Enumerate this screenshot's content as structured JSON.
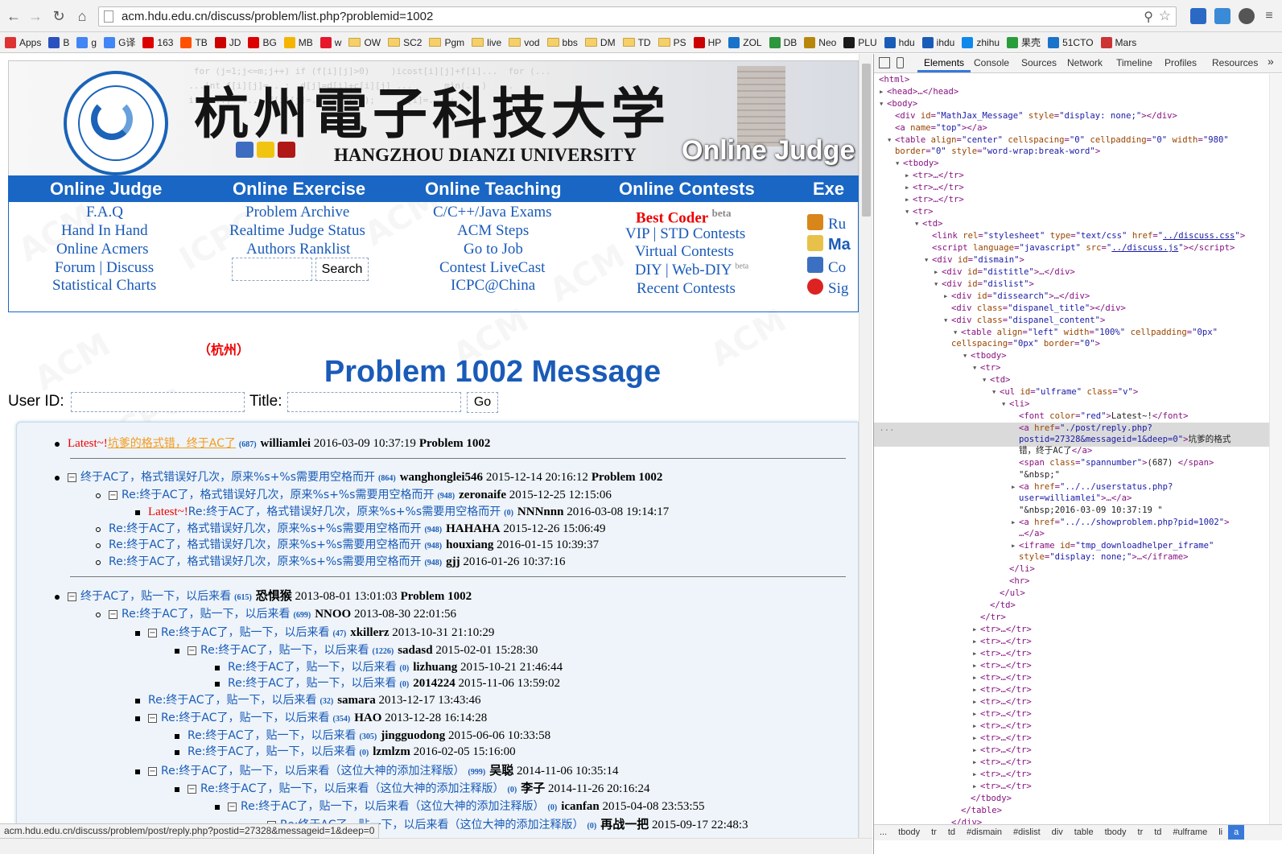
{
  "browser": {
    "url": "acm.hdu.edu.cn/discuss/problem/list.php?problemid=1002",
    "status_url": "acm.hdu.edu.cn/discuss/problem/post/reply.php?postid=27328&messageid=1&deep=0",
    "bookmarks": [
      {
        "label": "Apps",
        "icon": "apps-grid-icon",
        "color": "#d33"
      },
      {
        "label": "B",
        "icon": "baidu-icon",
        "color": "#2a52be"
      },
      {
        "label": "g",
        "icon": "google-icon",
        "color": "#4285f4"
      },
      {
        "label": "G译",
        "icon": "translate-icon",
        "color": "#4285f4"
      },
      {
        "label": "163",
        "icon": "netease-icon",
        "color": "#d00"
      },
      {
        "label": "TB",
        "icon": "taobao-icon",
        "color": "#ff5000"
      },
      {
        "label": "JD",
        "icon": "jd-icon",
        "color": "#c00"
      },
      {
        "label": "BG",
        "icon": "bg-icon",
        "color": "#d00"
      },
      {
        "label": "MB",
        "icon": "mb-icon",
        "color": "#f4b400"
      },
      {
        "label": "w",
        "icon": "weibo-icon",
        "color": "#e6162d"
      },
      {
        "label": "OW",
        "icon": "folder-icon"
      },
      {
        "label": "SC2",
        "icon": "folder-icon"
      },
      {
        "label": "Pgm",
        "icon": "folder-icon"
      },
      {
        "label": "live",
        "icon": "folder-icon"
      },
      {
        "label": "vod",
        "icon": "folder-icon"
      },
      {
        "label": "bbs",
        "icon": "folder-icon"
      },
      {
        "label": "DM",
        "icon": "folder-icon"
      },
      {
        "label": "TD",
        "icon": "folder-icon"
      },
      {
        "label": "PS",
        "icon": "folder-icon"
      },
      {
        "label": "HP",
        "icon": "hupu-icon",
        "color": "#c00"
      },
      {
        "label": "ZOL",
        "icon": "zol-icon",
        "color": "#1a73c9"
      },
      {
        "label": "DB",
        "icon": "douban-icon",
        "color": "#2e963d"
      },
      {
        "label": "Neo",
        "icon": "neo-icon",
        "color": "#b8860b"
      },
      {
        "label": "PLU",
        "icon": "plu-icon",
        "color": "#1a1a1a"
      },
      {
        "label": "hdu",
        "icon": "hdu-icon",
        "color": "#1a5bb8"
      },
      {
        "label": "ihdu",
        "icon": "ihdu-icon",
        "color": "#1a5bb8"
      },
      {
        "label": "zhihu",
        "icon": "zhihu-icon",
        "color": "#0f88eb"
      },
      {
        "label": "果壳",
        "icon": "guokr-icon",
        "color": "#2a9d3b"
      },
      {
        "label": "51CTO",
        "icon": "51cto-icon",
        "color": "#1a73c9"
      },
      {
        "label": "Mars",
        "icon": "mars-icon",
        "color": "#c33"
      }
    ]
  },
  "site": {
    "banner_cn": "杭州電子科技大学",
    "banner_en": "HANGZHOU DIANZI UNIVERSITY",
    "banner_oj": "Online Judge",
    "logo_ring": "HANGZHOU DIANZI UNIVERSITY",
    "nav": [
      {
        "head": "Online Judge",
        "links": [
          "F.A.Q",
          "Hand In Hand",
          "Online Acmers",
          "Forum | Discuss",
          "Statistical Charts"
        ]
      },
      {
        "head": "Online Exercise",
        "links": [
          "Problem Archive",
          "Realtime Judge Status",
          "Authors Ranklist"
        ]
      },
      {
        "head": "Online Teaching",
        "links": [
          "C/C++/Java Exams",
          "ACM Steps",
          "Go to Job",
          "Contest LiveCast",
          "ICPC@China"
        ]
      },
      {
        "head": "Online Contests",
        "links": [
          "Best Coder",
          "VIP | STD Contests",
          "Virtual Contests",
          "DIY | Web-DIY",
          "Recent Contests"
        ],
        "best_sup": "beta",
        "diy_sup": "beta"
      },
      {
        "head": "Exe",
        "links": [
          "Ru",
          "Ma",
          "Co",
          "Sig"
        ]
      }
    ],
    "search_button": "Search"
  },
  "discuss": {
    "city": "（杭州）",
    "title": "Problem 1002 Message",
    "userid_label": "User ID:",
    "title_label": "Title:",
    "go_label": "Go",
    "threads": [
      {
        "latest": "Latest~!",
        "title": "坑爹的格式错，终于AC了",
        "count": "(687)",
        "user": "williamlei",
        "time": "2016-03-09 10:37:19",
        "problem": "Problem 1002"
      },
      {
        "title": "终于AC了，格式错误好几次，原来%s+%s需要用空格而开",
        "count": "(864)",
        "user": "wanghonglei546",
        "time": "2015-12-14 20:16:12",
        "problem": "Problem 1002"
      },
      {
        "title": "Re:终于AC了，格式错误好几次，原来%s+%s需要用空格而开",
        "count": "(948)",
        "user": "zeronaife",
        "time": "2015-12-25 12:15:06"
      },
      {
        "latest": "Latest~!",
        "title": "Re:终于AC了，格式错误好几次，原来%s+%s需要用空格而开",
        "count": "(0)",
        "user": "NNNnnn",
        "time": "2016-03-08 19:14:17"
      },
      {
        "title": "Re:终于AC了，格式错误好几次，原来%s+%s需要用空格而开",
        "count": "(948)",
        "user": "HAHAHA",
        "time": "2015-12-26 15:06:49"
      },
      {
        "title": "Re:终于AC了，格式错误好几次，原来%s+%s需要用空格而开",
        "count": "(948)",
        "user": "houxiang",
        "time": "2016-01-15 10:39:37"
      },
      {
        "title": "Re:终于AC了，格式错误好几次，原来%s+%s需要用空格而开",
        "count": "(948)",
        "user": "gjj",
        "time": "2016-01-26 10:37:16"
      },
      {
        "title": "终于AC了，贴一下，以后来看",
        "count": "(615)",
        "user": "恐惧猴",
        "time": "2013-08-01 13:01:03",
        "problem": "Problem 1002"
      },
      {
        "title": "Re:终于AC了，贴一下，以后来看",
        "count": "(699)",
        "user": "NNOO",
        "time": "2013-08-30 22:01:56"
      },
      {
        "title": "Re:终于AC了，贴一下，以后来看",
        "count": "(47)",
        "user": "xkillerz",
        "time": "2013-10-31 21:10:29"
      },
      {
        "title": "Re:终于AC了，贴一下，以后来看",
        "count": "(1226)",
        "user": "sadasd",
        "time": "2015-02-01 15:28:30"
      },
      {
        "title": "Re:终于AC了，贴一下，以后来看",
        "count": "(0)",
        "user": "lizhuang",
        "time": "2015-10-21 21:46:44"
      },
      {
        "title": "Re:终于AC了，贴一下，以后来看",
        "count": "(0)",
        "user": "2014224",
        "time": "2015-11-06 13:59:02"
      },
      {
        "title": "Re:终于AC了，贴一下，以后来看",
        "count": "(32)",
        "user": "samara",
        "time": "2013-12-17 13:43:46"
      },
      {
        "title": "Re:终于AC了，贴一下，以后来看",
        "count": "(354)",
        "user": "HAO",
        "time": "2013-12-28 16:14:28"
      },
      {
        "title": "Re:终于AC了，贴一下，以后来看",
        "count": "(305)",
        "user": "jingguodong",
        "time": "2015-06-06 10:33:58"
      },
      {
        "title": "Re:终于AC了，贴一下，以后来看",
        "count": "(0)",
        "user": "lzmlzm",
        "time": "2016-02-05 15:16:00"
      },
      {
        "title": "Re:终于AC了，贴一下，以后来看（这位大神的添加注释版）",
        "count": "(999)",
        "user": "吴聪",
        "time": "2014-11-06 10:35:14"
      },
      {
        "title": "Re:终于AC了，贴一下，以后来看（这位大神的添加注释版）",
        "count": "(0)",
        "user": "李子",
        "time": "2014-11-26 20:16:24"
      },
      {
        "title": "Re:终于AC了，贴一下，以后来看（这位大神的添加注释版）",
        "count": "(0)",
        "user": "icanfan",
        "time": "2015-04-08 23:53:55"
      },
      {
        "title": "Re:终于AC了，贴一下，以后来看（这位大神的添加注释版）",
        "count": "(0)",
        "user": "再战一把",
        "time": "2015-09-17 22:48:3"
      }
    ]
  },
  "devtools": {
    "tabs": [
      "Elements",
      "Console",
      "Sources",
      "Network",
      "Timeline",
      "Profiles",
      "Resources"
    ],
    "active_tab": "Elements",
    "breadcrumbs": [
      "...",
      "tbody",
      "tr",
      "td",
      "#dismain",
      "#dislist",
      "div",
      "table",
      "tbody",
      "tr",
      "td",
      "#ulframe",
      "li",
      "a"
    ],
    "active_crumb": "a"
  }
}
